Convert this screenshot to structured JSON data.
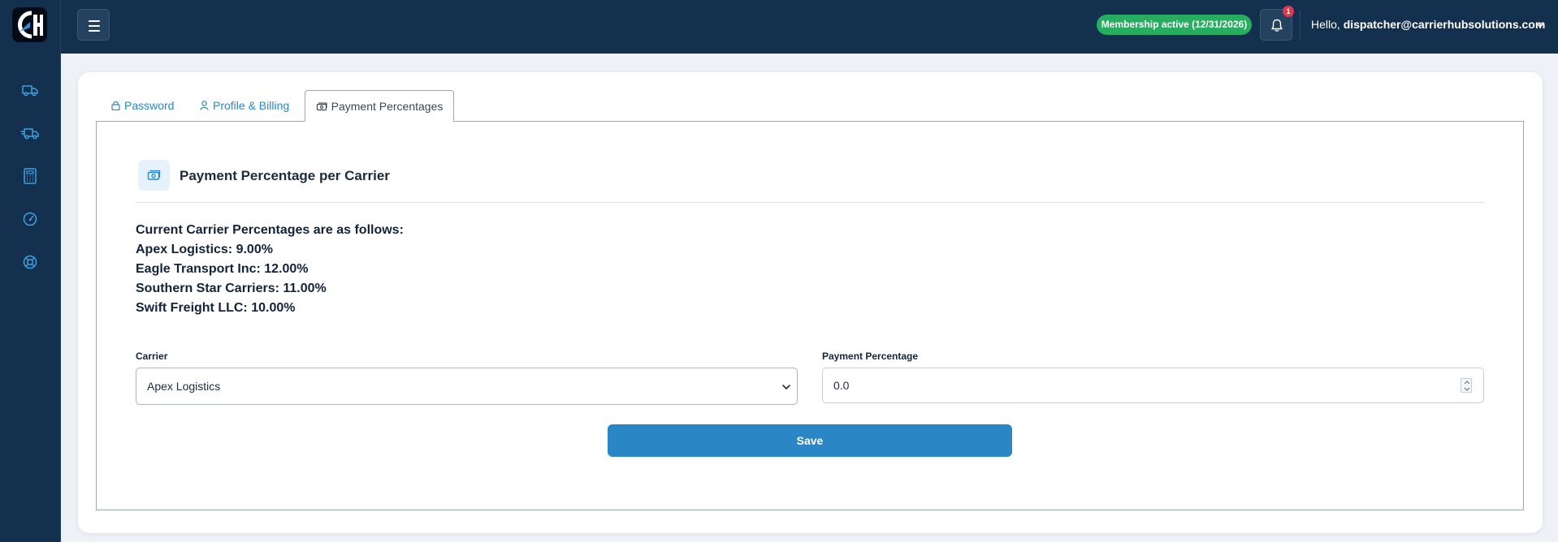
{
  "header": {
    "membership_badge": "Membership active (12/31/2026)",
    "notification_count": "1",
    "greeting": "Hello,",
    "user_email": "dispatcher@carrierhubsolutions.com"
  },
  "sidebar": {
    "icons": [
      "truck-icon",
      "truck-fast-icon",
      "calculator-icon",
      "gauge-icon",
      "lifebuoy-icon"
    ]
  },
  "tabs": [
    {
      "label": "Password",
      "icon": "lock-icon",
      "active": false
    },
    {
      "label": "Profile & Billing",
      "icon": "user-icon",
      "active": false
    },
    {
      "label": "Payment Percentages",
      "icon": "money-icon",
      "active": true
    }
  ],
  "section": {
    "title": "Payment Percentage per Carrier",
    "icon": "money-icon"
  },
  "current_percentages": {
    "heading": "Current Carrier Percentages are as follows:",
    "lines": [
      "Apex Logistics: 9.00%",
      "Eagle Transport Inc: 12.00%",
      "Southern Star Carriers: 11.00%",
      "Swift Freight LLC: 10.00%"
    ]
  },
  "form": {
    "carrier_label": "Carrier",
    "carrier_selected": "Apex Logistics",
    "percentage_label": "Payment Percentage",
    "percentage_value": "0.0",
    "save_label": "Save"
  },
  "colors": {
    "navbar": "#14304f",
    "accent": "#2a86c4",
    "membership_green": "#26ad60",
    "badge_red": "#e5354a"
  }
}
